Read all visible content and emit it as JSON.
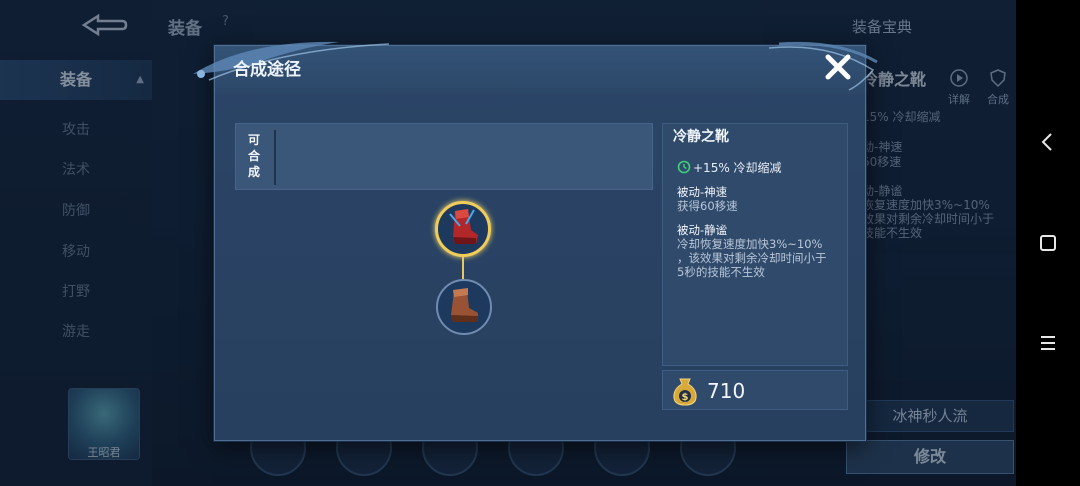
{
  "background": {
    "section_title": "装备",
    "help_glyph": "?",
    "encyclopedia_label": "装备宝典",
    "sidebar": [
      {
        "label": "装备",
        "active": true
      },
      {
        "label": "攻击"
      },
      {
        "label": "法术"
      },
      {
        "label": "防御"
      },
      {
        "label": "移动"
      },
      {
        "label": "打野"
      },
      {
        "label": "游走"
      }
    ],
    "right_panel": {
      "title": "冷静之靴",
      "detail_label": "详解",
      "compose_label": "合成",
      "lines": [
        "15% 冷却缩减",
        "动-神速",
        "60移速",
        "动-静谧",
        "恢复速度加快3%~10%",
        "效果对剩余冷却时间小于",
        "技能不生效"
      ]
    },
    "hero_name": "王昭君",
    "build_name": "冰神秒人流",
    "modify_label": "修改"
  },
  "modal": {
    "title": "合成途径",
    "close_icon": "close-x-icon",
    "combinable_label": [
      "可",
      "合",
      "成"
    ],
    "tree": {
      "top_item": {
        "name": "冷静之靴",
        "icon": "red-boots-icon"
      },
      "bottom_item": {
        "name": "鞋子",
        "icon": "brown-boots-icon"
      }
    },
    "info": {
      "name": "冷静之靴",
      "stat": "+15% 冷却缩减",
      "passive1_title": "被动-神速",
      "passive1_desc": "获得60移速",
      "passive2_title": "被动-静谧",
      "passive2_desc_lines": [
        "冷却恢复速度加快3%~10%",
        "，该效果对剩余冷却时间小于",
        "5秒的技能不生效"
      ]
    },
    "price": "710",
    "price_icon": "gold-bag-icon"
  },
  "colors": {
    "accent_gold": "#f0cc5a",
    "stat_green": "#3fcf7a",
    "panel": "#304a6b"
  }
}
